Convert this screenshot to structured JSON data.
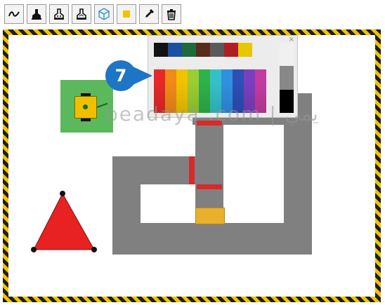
{
  "toolbar": {
    "tools": [
      "line-draw-icon",
      "stamp-icon",
      "stamp-dots-icon",
      "stamp-outline-icon",
      "cube-icon",
      "color-square-icon",
      "eyedropper-icon",
      "trash-icon"
    ]
  },
  "palette": {
    "close_label": "×",
    "top_row": [
      "#121212",
      "#1b4fa0",
      "#1d6a3a",
      "#5a2a1a",
      "#5a5a5a",
      "#b01e24",
      "#e6c800"
    ],
    "bottom_row": [
      "#e62828",
      "#f08a18",
      "#f2c200",
      "#9acd32",
      "#2fb14b",
      "#35c0c8",
      "#2f8fe0",
      "#2c4fb8",
      "#7a3fbf",
      "#c33ba0"
    ],
    "grays": [
      "#f0f0f0",
      "#888888",
      "#000000"
    ]
  },
  "step_badge": "7",
  "watermark": "beadaya .com | يمي",
  "colors": {
    "path": "#808080",
    "start_zone": "#5cb85c",
    "triangle": "#e82222",
    "hazard_yellow": "#f2c200",
    "badge_blue": "#1f75c5"
  }
}
